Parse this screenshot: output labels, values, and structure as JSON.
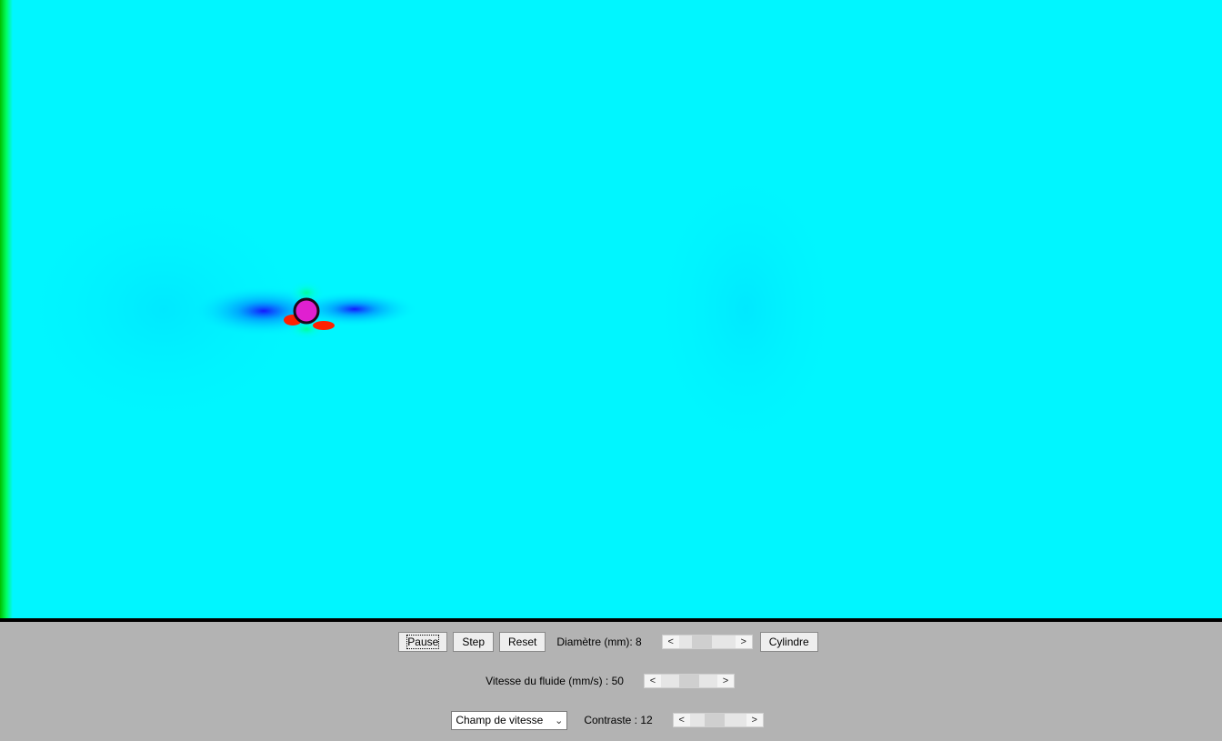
{
  "controls": {
    "pause_label": "Pause",
    "step_label": "Step",
    "reset_label": "Reset",
    "diameter_label": "Diamètre (mm): 8",
    "cylinder_label": "Cylindre",
    "speed_label": "Vitesse du fluide (mm/s) : 50",
    "field_select_value": "Champ de vitesse",
    "contrast_label": "Contraste : 12",
    "arrow_left": "<",
    "arrow_right": ">"
  },
  "sliders": {
    "diameter_level": 0.35,
    "speed_level": 0.5,
    "contrast_level": 0.4
  },
  "colors": {
    "fluid": "#00f6ff",
    "obstacle": "#e020d0",
    "wall": "#00d400",
    "panel": "#b3b3b3"
  }
}
